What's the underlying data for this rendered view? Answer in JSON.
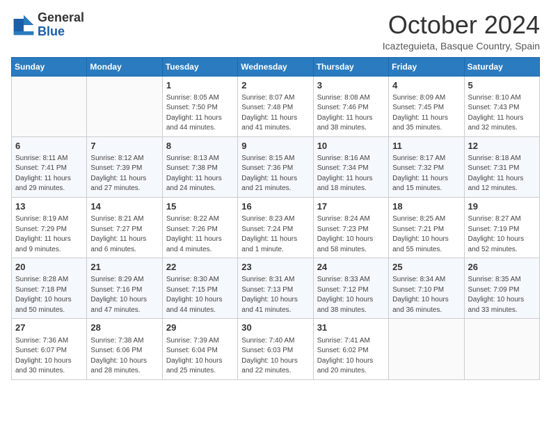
{
  "header": {
    "logo_line1": "General",
    "logo_line2": "Blue",
    "month": "October 2024",
    "location": "Icazteguieta, Basque Country, Spain"
  },
  "days_of_week": [
    "Sunday",
    "Monday",
    "Tuesday",
    "Wednesday",
    "Thursday",
    "Friday",
    "Saturday"
  ],
  "weeks": [
    [
      {
        "day": "",
        "sunrise": "",
        "sunset": "",
        "daylight": ""
      },
      {
        "day": "",
        "sunrise": "",
        "sunset": "",
        "daylight": ""
      },
      {
        "day": "1",
        "sunrise": "Sunrise: 8:05 AM",
        "sunset": "Sunset: 7:50 PM",
        "daylight": "Daylight: 11 hours and 44 minutes."
      },
      {
        "day": "2",
        "sunrise": "Sunrise: 8:07 AM",
        "sunset": "Sunset: 7:48 PM",
        "daylight": "Daylight: 11 hours and 41 minutes."
      },
      {
        "day": "3",
        "sunrise": "Sunrise: 8:08 AM",
        "sunset": "Sunset: 7:46 PM",
        "daylight": "Daylight: 11 hours and 38 minutes."
      },
      {
        "day": "4",
        "sunrise": "Sunrise: 8:09 AM",
        "sunset": "Sunset: 7:45 PM",
        "daylight": "Daylight: 11 hours and 35 minutes."
      },
      {
        "day": "5",
        "sunrise": "Sunrise: 8:10 AM",
        "sunset": "Sunset: 7:43 PM",
        "daylight": "Daylight: 11 hours and 32 minutes."
      }
    ],
    [
      {
        "day": "6",
        "sunrise": "Sunrise: 8:11 AM",
        "sunset": "Sunset: 7:41 PM",
        "daylight": "Daylight: 11 hours and 29 minutes."
      },
      {
        "day": "7",
        "sunrise": "Sunrise: 8:12 AM",
        "sunset": "Sunset: 7:39 PM",
        "daylight": "Daylight: 11 hours and 27 minutes."
      },
      {
        "day": "8",
        "sunrise": "Sunrise: 8:13 AM",
        "sunset": "Sunset: 7:38 PM",
        "daylight": "Daylight: 11 hours and 24 minutes."
      },
      {
        "day": "9",
        "sunrise": "Sunrise: 8:15 AM",
        "sunset": "Sunset: 7:36 PM",
        "daylight": "Daylight: 11 hours and 21 minutes."
      },
      {
        "day": "10",
        "sunrise": "Sunrise: 8:16 AM",
        "sunset": "Sunset: 7:34 PM",
        "daylight": "Daylight: 11 hours and 18 minutes."
      },
      {
        "day": "11",
        "sunrise": "Sunrise: 8:17 AM",
        "sunset": "Sunset: 7:32 PM",
        "daylight": "Daylight: 11 hours and 15 minutes."
      },
      {
        "day": "12",
        "sunrise": "Sunrise: 8:18 AM",
        "sunset": "Sunset: 7:31 PM",
        "daylight": "Daylight: 11 hours and 12 minutes."
      }
    ],
    [
      {
        "day": "13",
        "sunrise": "Sunrise: 8:19 AM",
        "sunset": "Sunset: 7:29 PM",
        "daylight": "Daylight: 11 hours and 9 minutes."
      },
      {
        "day": "14",
        "sunrise": "Sunrise: 8:21 AM",
        "sunset": "Sunset: 7:27 PM",
        "daylight": "Daylight: 11 hours and 6 minutes."
      },
      {
        "day": "15",
        "sunrise": "Sunrise: 8:22 AM",
        "sunset": "Sunset: 7:26 PM",
        "daylight": "Daylight: 11 hours and 4 minutes."
      },
      {
        "day": "16",
        "sunrise": "Sunrise: 8:23 AM",
        "sunset": "Sunset: 7:24 PM",
        "daylight": "Daylight: 11 hours and 1 minute."
      },
      {
        "day": "17",
        "sunrise": "Sunrise: 8:24 AM",
        "sunset": "Sunset: 7:23 PM",
        "daylight": "Daylight: 10 hours and 58 minutes."
      },
      {
        "day": "18",
        "sunrise": "Sunrise: 8:25 AM",
        "sunset": "Sunset: 7:21 PM",
        "daylight": "Daylight: 10 hours and 55 minutes."
      },
      {
        "day": "19",
        "sunrise": "Sunrise: 8:27 AM",
        "sunset": "Sunset: 7:19 PM",
        "daylight": "Daylight: 10 hours and 52 minutes."
      }
    ],
    [
      {
        "day": "20",
        "sunrise": "Sunrise: 8:28 AM",
        "sunset": "Sunset: 7:18 PM",
        "daylight": "Daylight: 10 hours and 50 minutes."
      },
      {
        "day": "21",
        "sunrise": "Sunrise: 8:29 AM",
        "sunset": "Sunset: 7:16 PM",
        "daylight": "Daylight: 10 hours and 47 minutes."
      },
      {
        "day": "22",
        "sunrise": "Sunrise: 8:30 AM",
        "sunset": "Sunset: 7:15 PM",
        "daylight": "Daylight: 10 hours and 44 minutes."
      },
      {
        "day": "23",
        "sunrise": "Sunrise: 8:31 AM",
        "sunset": "Sunset: 7:13 PM",
        "daylight": "Daylight: 10 hours and 41 minutes."
      },
      {
        "day": "24",
        "sunrise": "Sunrise: 8:33 AM",
        "sunset": "Sunset: 7:12 PM",
        "daylight": "Daylight: 10 hours and 38 minutes."
      },
      {
        "day": "25",
        "sunrise": "Sunrise: 8:34 AM",
        "sunset": "Sunset: 7:10 PM",
        "daylight": "Daylight: 10 hours and 36 minutes."
      },
      {
        "day": "26",
        "sunrise": "Sunrise: 8:35 AM",
        "sunset": "Sunset: 7:09 PM",
        "daylight": "Daylight: 10 hours and 33 minutes."
      }
    ],
    [
      {
        "day": "27",
        "sunrise": "Sunrise: 7:36 AM",
        "sunset": "Sunset: 6:07 PM",
        "daylight": "Daylight: 10 hours and 30 minutes."
      },
      {
        "day": "28",
        "sunrise": "Sunrise: 7:38 AM",
        "sunset": "Sunset: 6:06 PM",
        "daylight": "Daylight: 10 hours and 28 minutes."
      },
      {
        "day": "29",
        "sunrise": "Sunrise: 7:39 AM",
        "sunset": "Sunset: 6:04 PM",
        "daylight": "Daylight: 10 hours and 25 minutes."
      },
      {
        "day": "30",
        "sunrise": "Sunrise: 7:40 AM",
        "sunset": "Sunset: 6:03 PM",
        "daylight": "Daylight: 10 hours and 22 minutes."
      },
      {
        "day": "31",
        "sunrise": "Sunrise: 7:41 AM",
        "sunset": "Sunset: 6:02 PM",
        "daylight": "Daylight: 10 hours and 20 minutes."
      },
      {
        "day": "",
        "sunrise": "",
        "sunset": "",
        "daylight": ""
      },
      {
        "day": "",
        "sunrise": "",
        "sunset": "",
        "daylight": ""
      }
    ]
  ]
}
